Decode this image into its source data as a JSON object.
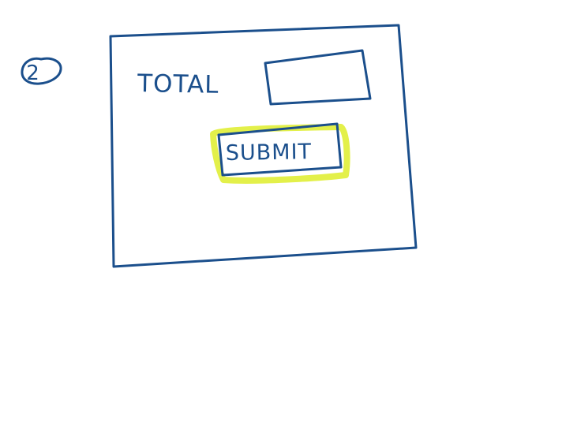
{
  "step": {
    "number": "2"
  },
  "form": {
    "total_label": "TOTAL",
    "total_value": "",
    "submit_label": "SUBMIT"
  },
  "colors": {
    "ink": "#1b4f8c",
    "highlight": "#e3f04a",
    "background": "#ffffff"
  },
  "highlighted_element": "submit-button"
}
